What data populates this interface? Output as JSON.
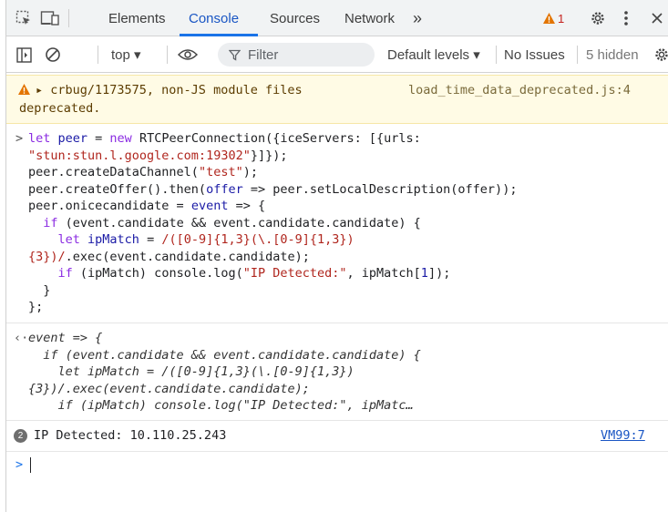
{
  "tabbar": {
    "tabs": [
      {
        "label": "Elements"
      },
      {
        "label": "Console"
      },
      {
        "label": "Sources"
      },
      {
        "label": "Network"
      }
    ],
    "more_label": "»",
    "warning_count": "1"
  },
  "toolbar": {
    "context": "top ▾",
    "filter_placeholder": "Filter",
    "levels": "Default levels ▾",
    "issues": "No Issues",
    "hidden": "5 hidden"
  },
  "warning": {
    "line1": "▸ crbug/1173575, non-JS module files",
    "line2": "deprecated.",
    "source": "load_time_data_deprecated.js:4"
  },
  "input_code": {
    "l1a": "let ",
    "l1b": "peer",
    "l1c": " = ",
    "l1d": "new ",
    "l1e": "RTCPeerConnection({iceServers: [{urls:",
    "l2": "\"stun:stun.l.google.com:19302\"",
    "l2b": "}]});",
    "l3a": "peer.createDataChannel(",
    "l3b": "\"test\"",
    "l3c": ");",
    "l4a": "peer.createOffer().then(",
    "l4b": "offer",
    "l4c": " => peer.setLocalDescription(offer));",
    "l5a": "peer.onicecandidate = ",
    "l5b": "event",
    "l5c": " => {",
    "l6a": "  ",
    "l6b": "if",
    "l6c": " (event.candidate && event.candidate.candidate) {",
    "l7a": "    ",
    "l7b": "let ",
    "l7c": "ipMatch",
    "l7d": " = ",
    "l7e": "/([0-9]{1,3}(\\.[0-9]{1,3})",
    "l8a": "{3})/",
    "l8b": ".exec(event.candidate.candidate);",
    "l9a": "    ",
    "l9b": "if",
    "l9c": " (ipMatch) console.log(",
    "l9d": "\"IP Detected:\"",
    "l9e": ", ipMatch[",
    "l9f": "1",
    "l9g": "]);",
    "l10": "  }",
    "l11": "};"
  },
  "result": {
    "l1": "event => {",
    "l2": "  if (event.candidate && event.candidate.candidate) {",
    "l3": "    let ipMatch = /([0-9]{1,3}(\\.[0-9]{1,3})",
    "l4": "{3})/.exec(event.candidate.candidate);",
    "l5": "    if (ipMatch) console.log(\"IP Detected:\", ipMatc…"
  },
  "log": {
    "count": "2",
    "message": "IP Detected: 10.110.25.243",
    "source": "VM99:7"
  },
  "colors": {
    "accent": "#1a73e8",
    "warning_bg": "#fffbe5",
    "warning_icon": "#e37400",
    "keyword": "#8a2be2",
    "string": "#b0261e"
  }
}
